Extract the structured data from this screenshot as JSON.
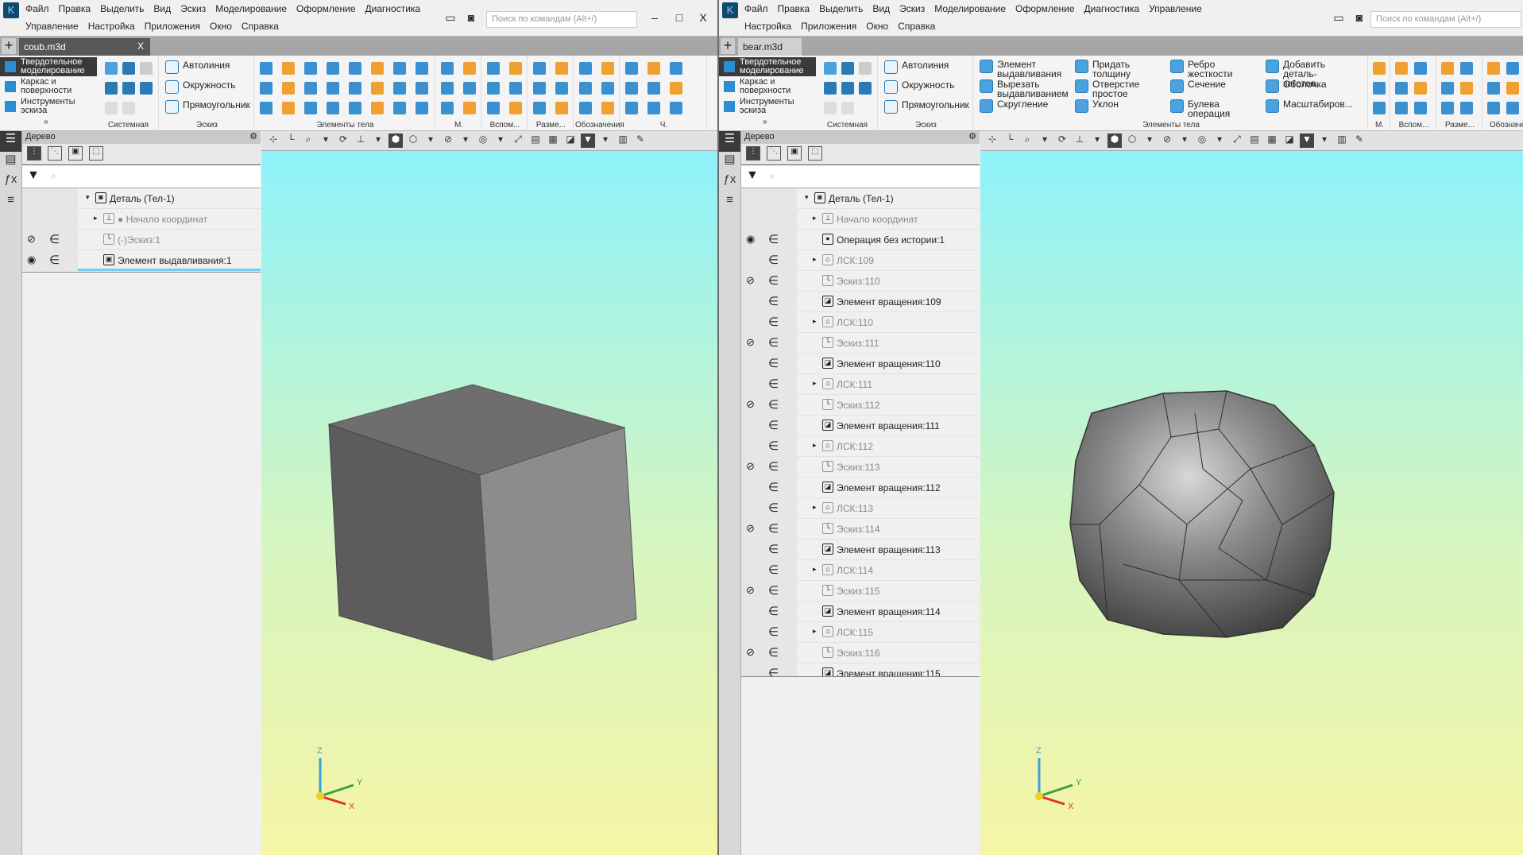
{
  "left": {
    "menu": [
      "Файл",
      "Правка",
      "Выделить",
      "Вид",
      "Эскиз",
      "Моделирование",
      "Оформление",
      "Диагностика",
      "Управление",
      "Настройка",
      "Приложения",
      "Окно",
      "Справка"
    ],
    "search_placeholder": "Поиск по командам (Alt+/)",
    "tab": "coub.m3d",
    "modes": [
      "Твердотельное моделирование",
      "Каркас и поверхности",
      "Инструменты эскиза"
    ],
    "sketch_buttons": [
      "Автолиния",
      "Окружность",
      "Прямоугольник"
    ],
    "groups": [
      "Системная",
      "Эскиз",
      "Элементы тела",
      "М.",
      "Вспом...",
      "Разме...",
      "Обозначения",
      "Ч."
    ],
    "tree_title": "Дерево",
    "tree": [
      {
        "label": "Деталь (Тел-1)",
        "level": 0,
        "expand": "▾",
        "eye": "",
        "inc": false,
        "icon": "part",
        "dim": false
      },
      {
        "label": "● Начало координат",
        "level": 1,
        "expand": "▸",
        "eye": "",
        "inc": false,
        "icon": "origin",
        "dim": true
      },
      {
        "label": "(-)Эскиз:1",
        "level": 1,
        "expand": "",
        "eye": "hidden",
        "inc": true,
        "icon": "sketch",
        "dim": true
      },
      {
        "label": "Элемент выдавливания:1",
        "level": 1,
        "expand": "",
        "eye": "visible",
        "inc": true,
        "icon": "extrude",
        "dim": false,
        "selected": true
      }
    ]
  },
  "right": {
    "menu": [
      "Файл",
      "Правка",
      "Выделить",
      "Вид",
      "Эскиз",
      "Моделирование",
      "Оформление",
      "Диагностика",
      "Управление",
      "Настройка",
      "Приложения",
      "Окно",
      "Справка"
    ],
    "search_placeholder": "Поиск по командам (Alt+/)",
    "tab": "bear.m3d",
    "modes": [
      "Твердотельное моделирование",
      "Каркас и поверхности",
      "Инструменты эскиза"
    ],
    "sketch_buttons": [
      "Автолиния",
      "Окружность",
      "Прямоугольник"
    ],
    "body_buttons": [
      "Элемент выдавливания",
      "Придать толщину",
      "Ребро жесткости",
      "Добавить деталь-заготов...",
      "Вырезать выдавливанием",
      "Отверстие простое",
      "Сечение",
      "Оболочка",
      "Скругление",
      "Уклон",
      "Булева операция",
      "Масштабиров..."
    ],
    "groups": [
      "Системная",
      "Эскиз",
      "Элементы тела",
      "М.",
      "Вспом...",
      "Разме...",
      "Обозначе"
    ],
    "tree_title": "Дерево",
    "tree": [
      {
        "label": "Деталь (Тел-1)",
        "level": 0,
        "expand": "▾",
        "eye": "",
        "inc": false,
        "icon": "part",
        "dim": false
      },
      {
        "label": "Начало координат",
        "level": 1,
        "expand": "▸",
        "eye": "",
        "inc": false,
        "icon": "origin",
        "dim": true
      },
      {
        "label": "Операция без истории:1",
        "level": 1,
        "expand": "",
        "eye": "visible",
        "inc": true,
        "icon": "solid",
        "dim": false
      },
      {
        "label": "ЛСК:109",
        "level": 1,
        "expand": "▸",
        "eye": "",
        "inc": true,
        "icon": "lcs",
        "dim": true
      },
      {
        "label": "Эскиз:110",
        "level": 1,
        "expand": "",
        "eye": "hidden",
        "inc": true,
        "icon": "sketch",
        "dim": true
      },
      {
        "label": "Элемент вращения:109",
        "level": 1,
        "expand": "",
        "eye": "",
        "inc": true,
        "icon": "revolve",
        "dim": false
      },
      {
        "label": "ЛСК:110",
        "level": 1,
        "expand": "▸",
        "eye": "",
        "inc": true,
        "icon": "lcs",
        "dim": true
      },
      {
        "label": "Эскиз:111",
        "level": 1,
        "expand": "",
        "eye": "hidden",
        "inc": true,
        "icon": "sketch",
        "dim": true
      },
      {
        "label": "Элемент вращения:110",
        "level": 1,
        "expand": "",
        "eye": "",
        "inc": true,
        "icon": "revolve",
        "dim": false
      },
      {
        "label": "ЛСК:111",
        "level": 1,
        "expand": "▸",
        "eye": "",
        "inc": true,
        "icon": "lcs",
        "dim": true
      },
      {
        "label": "Эскиз:112",
        "level": 1,
        "expand": "",
        "eye": "hidden",
        "inc": true,
        "icon": "sketch",
        "dim": true
      },
      {
        "label": "Элемент вращения:111",
        "level": 1,
        "expand": "",
        "eye": "",
        "inc": true,
        "icon": "revolve",
        "dim": false
      },
      {
        "label": "ЛСК:112",
        "level": 1,
        "expand": "▸",
        "eye": "",
        "inc": true,
        "icon": "lcs",
        "dim": true
      },
      {
        "label": "Эскиз:113",
        "level": 1,
        "expand": "",
        "eye": "hidden",
        "inc": true,
        "icon": "sketch",
        "dim": true
      },
      {
        "label": "Элемент вращения:112",
        "level": 1,
        "expand": "",
        "eye": "",
        "inc": true,
        "icon": "revolve",
        "dim": false
      },
      {
        "label": "ЛСК:113",
        "level": 1,
        "expand": "▸",
        "eye": "",
        "inc": true,
        "icon": "lcs",
        "dim": true
      },
      {
        "label": "Эскиз:114",
        "level": 1,
        "expand": "",
        "eye": "hidden",
        "inc": true,
        "icon": "sketch",
        "dim": true
      },
      {
        "label": "Элемент вращения:113",
        "level": 1,
        "expand": "",
        "eye": "",
        "inc": true,
        "icon": "revolve",
        "dim": false
      },
      {
        "label": "ЛСК:114",
        "level": 1,
        "expand": "▸",
        "eye": "",
        "inc": true,
        "icon": "lcs",
        "dim": true
      },
      {
        "label": "Эскиз:115",
        "level": 1,
        "expand": "",
        "eye": "hidden",
        "inc": true,
        "icon": "sketch",
        "dim": true
      },
      {
        "label": "Элемент вращения:114",
        "level": 1,
        "expand": "",
        "eye": "",
        "inc": true,
        "icon": "revolve",
        "dim": false
      },
      {
        "label": "ЛСК:115",
        "level": 1,
        "expand": "▸",
        "eye": "",
        "inc": true,
        "icon": "lcs",
        "dim": true
      },
      {
        "label": "Эскиз:116",
        "level": 1,
        "expand": "",
        "eye": "hidden",
        "inc": true,
        "icon": "sketch",
        "dim": true
      },
      {
        "label": "Элемент вращения:115",
        "level": 1,
        "expand": "",
        "eye": "",
        "inc": true,
        "icon": "revolve",
        "dim": false
      }
    ]
  },
  "axes": {
    "x": "X",
    "y": "Y",
    "z": "Z"
  },
  "colors": {
    "accent": "#2a8fd0",
    "selection": "#6ed0ee",
    "dark_panel": "#3a3a3a"
  }
}
